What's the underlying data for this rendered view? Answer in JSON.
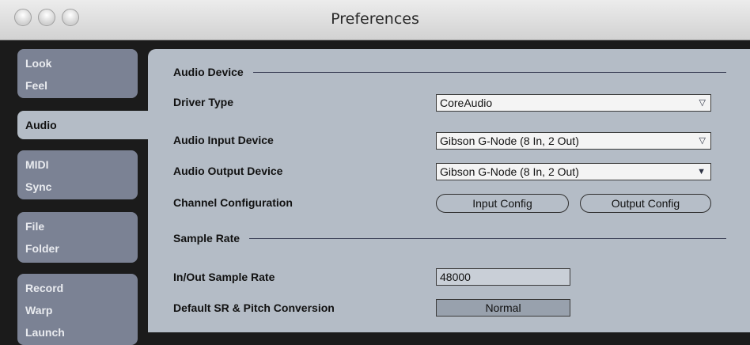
{
  "window": {
    "title": "Preferences"
  },
  "sidebar": {
    "tabs": [
      {
        "line1": "Look",
        "line2": "Feel"
      },
      {
        "line1": "Audio"
      },
      {
        "line1": "MIDI",
        "line2": "Sync"
      },
      {
        "line1": "File",
        "line2": "Folder"
      },
      {
        "line1": "Record",
        "line2": "Warp",
        "line3": "Launch"
      }
    ],
    "active": "Audio"
  },
  "audio_device": {
    "heading": "Audio Device",
    "driver_type": {
      "label": "Driver Type",
      "value": "CoreAudio"
    },
    "input_device": {
      "label": "Audio Input Device",
      "value": "Gibson G-Node (8 In, 2 Out)"
    },
    "output_device": {
      "label": "Audio Output Device",
      "value": "Gibson G-Node (8 In, 2 Out)"
    },
    "channel_config": {
      "label": "Channel Configuration",
      "input_button": "Input Config",
      "output_button": "Output Config"
    }
  },
  "sample_rate": {
    "heading": "Sample Rate",
    "inout": {
      "label": "In/Out Sample Rate",
      "value": "48000"
    },
    "conversion": {
      "label": "Default SR & Pitch Conversion",
      "value": "Normal"
    }
  },
  "icons": {
    "dropdown_arrow": "▽",
    "dropdown_arrow_filled": "▼"
  },
  "colors": {
    "panel": "#b4bcc6",
    "tab": "#7b8294",
    "background": "#1b1b1b"
  }
}
